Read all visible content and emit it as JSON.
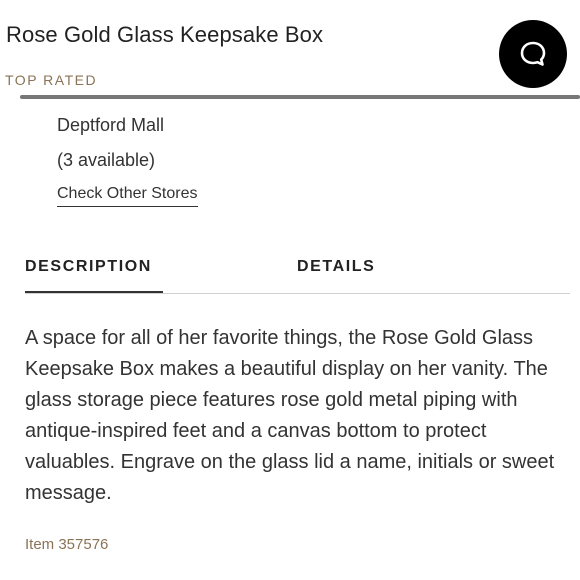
{
  "product": {
    "title": "Rose Gold Glass Keepsake Box",
    "badge": "TOP RATED"
  },
  "chat": {
    "icon": "chat-bubble-icon"
  },
  "store": {
    "name": "Deptford Mall",
    "availability": "(3 available)",
    "check_other_label": "Check Other Stores"
  },
  "tabs": [
    {
      "label": "DESCRIPTION",
      "active": true
    },
    {
      "label": "DETAILS",
      "active": false
    }
  ],
  "description": "A space for all of her favorite things, the Rose Gold Glass Keepsake Box makes a beautiful display on her vanity. The glass storage piece features rose gold metal piping with antique-inspired feet and a canvas bottom to protect valuables. Engrave on the glass lid a name, initials or sweet message.",
  "item_number": "Item 357576",
  "colors": {
    "accent_brown": "#8a7356",
    "text": "#333333",
    "chat_button": "#000000"
  }
}
